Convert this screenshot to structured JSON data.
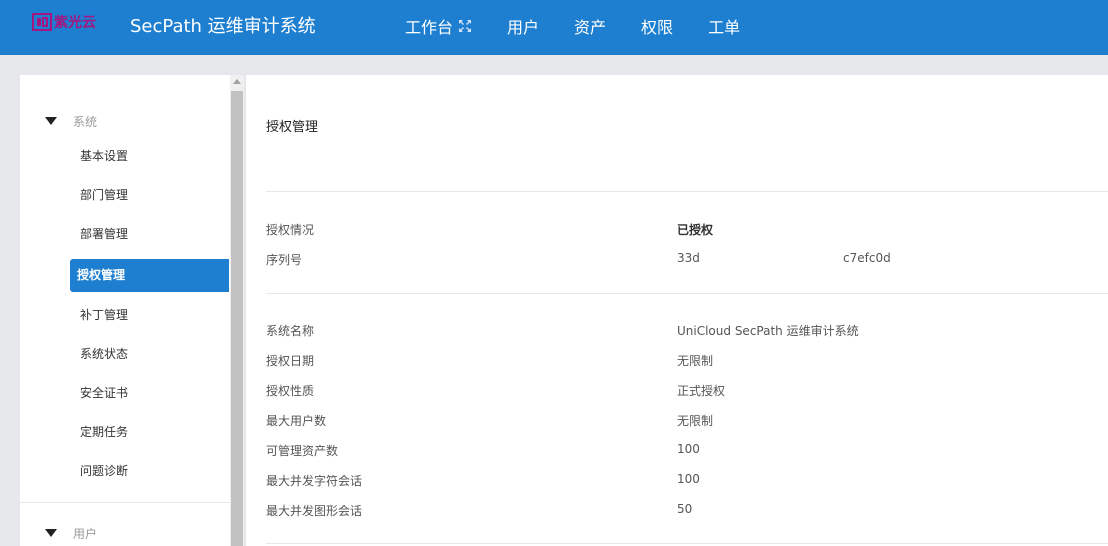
{
  "header": {
    "logo_text": "紫光云",
    "app_title": "SecPath 运维审计系统",
    "nav": [
      "工作台",
      "用户",
      "资产",
      "权限",
      "工单"
    ]
  },
  "sidebar": {
    "group1": "系统",
    "items": [
      "基本设置",
      "部门管理",
      "部署管理",
      "授权管理",
      "补丁管理",
      "系统状态",
      "安全证书",
      "定期任务",
      "问题诊断"
    ],
    "active_index": 3,
    "group2": "用户"
  },
  "main": {
    "title": "授权管理",
    "section1": [
      {
        "label": "授权情况",
        "value": "已授权"
      },
      {
        "label": "序列号",
        "value": "33d",
        "value2": "c7efc0d"
      }
    ],
    "section2": [
      {
        "label": "系统名称",
        "value": "UniCloud SecPath 运维审计系统"
      },
      {
        "label": "授权日期",
        "value": "无限制"
      },
      {
        "label": "授权性质",
        "value": "正式授权"
      },
      {
        "label": "最大用户数",
        "value": "无限制"
      },
      {
        "label": "可管理资产数",
        "value": "100"
      },
      {
        "label": "最大并发字符会话",
        "value": "100"
      },
      {
        "label": "最大并发图形会话",
        "value": "50"
      }
    ]
  },
  "colors": {
    "header_bg": "#1e7fd0",
    "logo": "#a3157f",
    "active_item": "#1e7fd0"
  }
}
